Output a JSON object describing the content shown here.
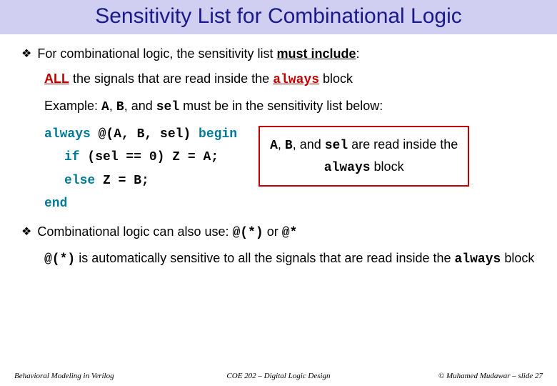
{
  "title": "Sensitivity List for Combinational Logic",
  "bullet1_prefix": "For combinational logic, the sensitivity list ",
  "bullet1_em": "must include",
  "bullet1_suffix": ":",
  "line2_a": "ALL",
  "line2_b": " the signals that are read inside the ",
  "line2_c": "always",
  "line2_d": " block",
  "line3_a": "Example: ",
  "line3_b": "A",
  "line3_c": ", ",
  "line3_d": "B",
  "line3_e": ", and ",
  "line3_f": "sel",
  "line3_g": " must be in the sensitivity list below:",
  "code": {
    "k_always": "always",
    "atlist": " @(A, B, sel) ",
    "k_begin": "begin",
    "k_if": "if",
    "ifcond": " (sel == 0) Z = A;",
    "k_else": "else",
    "elsebody": " Z = B;",
    "k_end": "end"
  },
  "note_a": "A",
  "note_b": ", ",
  "note_c": "B",
  "note_d": ", and ",
  "note_e": "sel",
  "note_f": " are read inside the ",
  "note_g": "always",
  "note_h": " block",
  "bullet2_a": "Combinational logic can also use: ",
  "bullet2_b": "@(*)",
  "bullet2_c": " or ",
  "bullet2_d": "@*",
  "line4_a": "@(*)",
  "line4_b": " is automatically sensitive to all the signals that are read inside the ",
  "line4_c": "always",
  "line4_d": " block",
  "footer": {
    "left": "Behavioral Modeling in Verilog",
    "center": "COE 202 – Digital Logic Design",
    "right": "© Muhamed Mudawar – slide 27"
  }
}
